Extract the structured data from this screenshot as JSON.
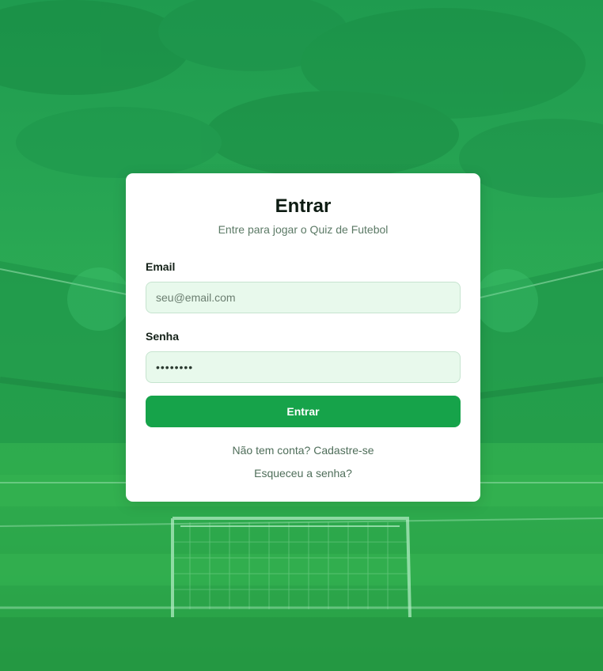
{
  "login": {
    "title": "Entrar",
    "subtitle": "Entre para jogar o Quiz de Futebol",
    "email_label": "Email",
    "email_placeholder": "seu@email.com",
    "password_label": "Senha",
    "password_value": "••••••••",
    "submit_label": "Entrar",
    "signup_link": "Não tem conta? Cadastre-se",
    "forgot_link": "Esqueceu a senha?"
  },
  "colors": {
    "primary": "#16a34a",
    "input_bg": "#e8f9ec",
    "background": "#27a553"
  }
}
